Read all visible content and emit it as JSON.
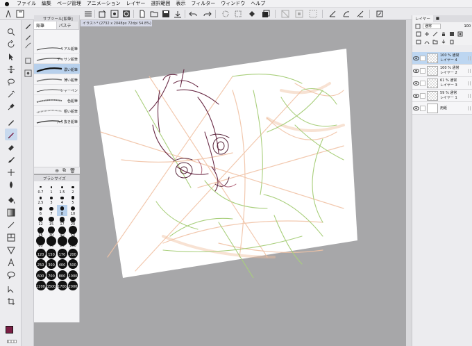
{
  "menubar": {
    "apple": "",
    "items": [
      "ファイル",
      "編集",
      "ページ管理",
      "アニメーション",
      "レイヤー",
      "選択範囲",
      "表示",
      "フィルター",
      "ウィンドウ",
      "ヘルプ"
    ]
  },
  "subtool": {
    "header": "サブツール[鉛筆]",
    "tabs": [
      "鉛筆",
      "パステ"
    ],
    "brushes": [
      "リアル鉛筆",
      "デッサン鉛筆",
      "濃い鉛筆",
      "薄い鉛筆",
      "シャーペン",
      "色鉛筆",
      "粗い鉛筆",
      "入り抜き鉛筆"
    ],
    "selected_brush": "濃い鉛筆"
  },
  "brushsize": {
    "header": "ブラシサイズ",
    "sizes": [
      "0.7",
      "1",
      "1.5",
      "2",
      "2.5",
      "3",
      "4",
      "5",
      "6",
      "7",
      "8",
      "10",
      "12",
      "15",
      "17",
      "20",
      "25",
      "30",
      "40",
      "50",
      "60",
      "70",
      "80",
      "100",
      "120",
      "150",
      "170",
      "200",
      "250",
      "300",
      "400",
      "500",
      "600",
      "700",
      "800",
      "1000",
      "1200",
      "1500",
      "1700",
      "2000"
    ],
    "selected": "8"
  },
  "colors": {
    "main": "#7a1e44",
    "sub": "#ffffff"
  },
  "document": {
    "tab_label": "イラスト* (2732 x 2048px 72dpi 54.8%)"
  },
  "layers_panel": {
    "tabs": [
      "レイヤー",
      "■"
    ],
    "blend_mode": "通常",
    "opacity": "100",
    "layers": [
      {
        "opacity": "100 %",
        "mode": "通常",
        "name": "レイヤー 4",
        "selected": true
      },
      {
        "opacity": "100 %",
        "mode": "通常",
        "name": "レイヤー 2",
        "selected": false
      },
      {
        "opacity": "61 %",
        "mode": "通常",
        "name": "レイヤー 3",
        "selected": false
      },
      {
        "opacity": "59 %",
        "mode": "通常",
        "name": "レイヤー 1",
        "selected": false
      },
      {
        "opacity": "",
        "mode": "",
        "name": "用紙",
        "selected": false
      }
    ]
  }
}
